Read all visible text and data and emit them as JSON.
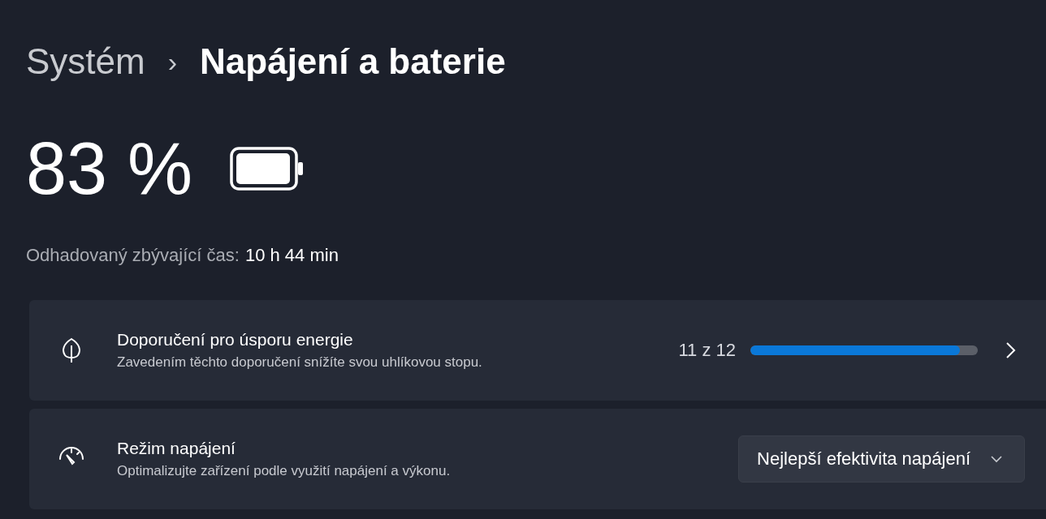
{
  "breadcrumb": {
    "parent": "Systém",
    "separator": "›",
    "current": "Napájení a baterie"
  },
  "battery": {
    "percent": "83 %",
    "estimate_label": "Odhadovaný zbývající čas:",
    "estimate_value": "10 h 44 min"
  },
  "cards": [
    {
      "kind": "progress",
      "title": "Doporučení pro úsporu energie",
      "description": "Zavedením těchto doporučení snížíte svou uhlíkovou stopu.",
      "count": "11 z 12",
      "level": 0.92
    },
    {
      "kind": "dropdown",
      "title": "Režim napájení",
      "description": "Optimalizujte zařízení podle využití napájení a výkonu.",
      "value": "Nejlepší efektivita napájení"
    }
  ]
}
